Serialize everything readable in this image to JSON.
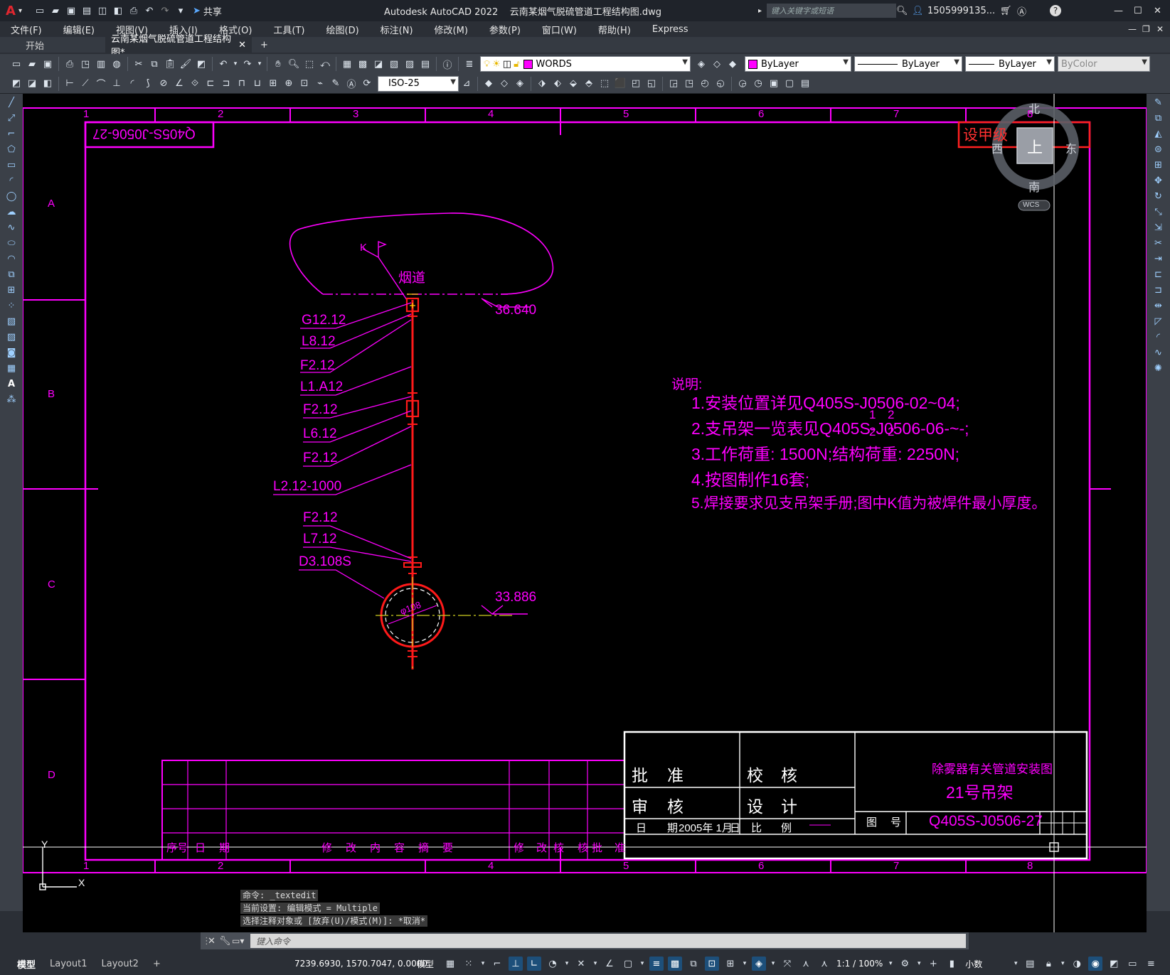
{
  "titlebar": {
    "app_title": "Autodesk AutoCAD 2022",
    "file_name": "云南某烟气脱硫管道工程结构图.dwg",
    "share_label": "共享",
    "search_placeholder": "键入关键字或短语",
    "user": "1505999135..."
  },
  "menu": [
    "文件(F)",
    "编辑(E)",
    "视图(V)",
    "插入(I)",
    "格式(O)",
    "工具(T)",
    "绘图(D)",
    "标注(N)",
    "修改(M)",
    "参数(P)",
    "窗口(W)",
    "帮助(H)",
    "Express"
  ],
  "tabs": {
    "start": "开始",
    "active_doc": "云南某烟气脱硫管道工程结构图*"
  },
  "toolbar": {
    "layer_name": "WORDS",
    "layer_color": "#ff00ff",
    "color_value": "ByLayer",
    "linetype_value": "ByLayer",
    "lineweight_value": "ByLayer",
    "plotstyle_value": "ByColor",
    "dimstyle_value": "ISO-25"
  },
  "drawing": {
    "frame_color": "#ff00ff",
    "pipe_color": "#ff1a1a",
    "drawing_number_mirrored": "Q405S-J0506-27",
    "stamp": "设甲级",
    "col_numbers": [
      "1",
      "2",
      "3",
      "4",
      "5",
      "6",
      "7",
      "8"
    ],
    "row_letters": [
      "A",
      "B",
      "C",
      "D"
    ],
    "duct_label": "烟道",
    "k_label": "K",
    "elevation_top": "36.640",
    "elevation_bottom": "33.886",
    "pipe_dia_label": "φ108",
    "labels": [
      "G12.12",
      "L8.12",
      "F2.12",
      "L1.A12",
      "F2.12",
      "L6.12",
      "F2.12",
      "L2.12-1000",
      "F2.12",
      "L7.12",
      "D3.108S"
    ],
    "notes_title": "说明:",
    "notes": [
      "1.安装位置详见Q405S-J0506-02~04;",
      "2.支吊架一览表见Q405S-J0506-06-~-;",
      "3.工作荷重: 1500N;结构荷重: 2250N;",
      "4.按图制作16套;",
      "5.焊接要求见支吊架手册;图中K值为被焊件最小厚度。"
    ],
    "notes_fraction": [
      "1",
      "2",
      "2",
      "2"
    ],
    "revision_headers": [
      "序号",
      "日",
      "期",
      "修",
      "改",
      "内",
      "容",
      "摘",
      "要",
      "修",
      "改",
      "核",
      "核",
      "批",
      "准"
    ],
    "title_block": {
      "approve": [
        "批",
        "准"
      ],
      "check": [
        "校",
        "核"
      ],
      "review": [
        "审",
        "核"
      ],
      "design": [
        "设",
        "计"
      ],
      "date_label": [
        "日",
        "期"
      ],
      "date_value": "2005年 1月",
      "day_char": "日",
      "scale_label": [
        "比",
        "例"
      ],
      "scale_value": "——",
      "project_title": "除雾器有关管道安装图",
      "drawing_title": "21号吊架",
      "drawing_no_label": [
        "图",
        "号"
      ],
      "drawing_no": "Q405S-J0506-27"
    }
  },
  "viewcube": {
    "north": "北",
    "south": "南",
    "east": "东",
    "west": "西",
    "top": "上",
    "wcs": "WCS"
  },
  "ucs": {
    "x": "X",
    "y": "Y"
  },
  "command_history": [
    "命令: _textedit",
    "当前设置: 编辑模式 = Multiple",
    "选择注释对象或 [放弃(U)/模式(M)]: *取消*"
  ],
  "command_placeholder": "键入命令",
  "status": {
    "model_tab": "模型",
    "layout1": "Layout1",
    "layout2": "Layout2",
    "coords": "7239.6930, 1570.7047, 0.0000",
    "space": "模型",
    "scale": "1:1 / 100%",
    "units": "小数"
  }
}
